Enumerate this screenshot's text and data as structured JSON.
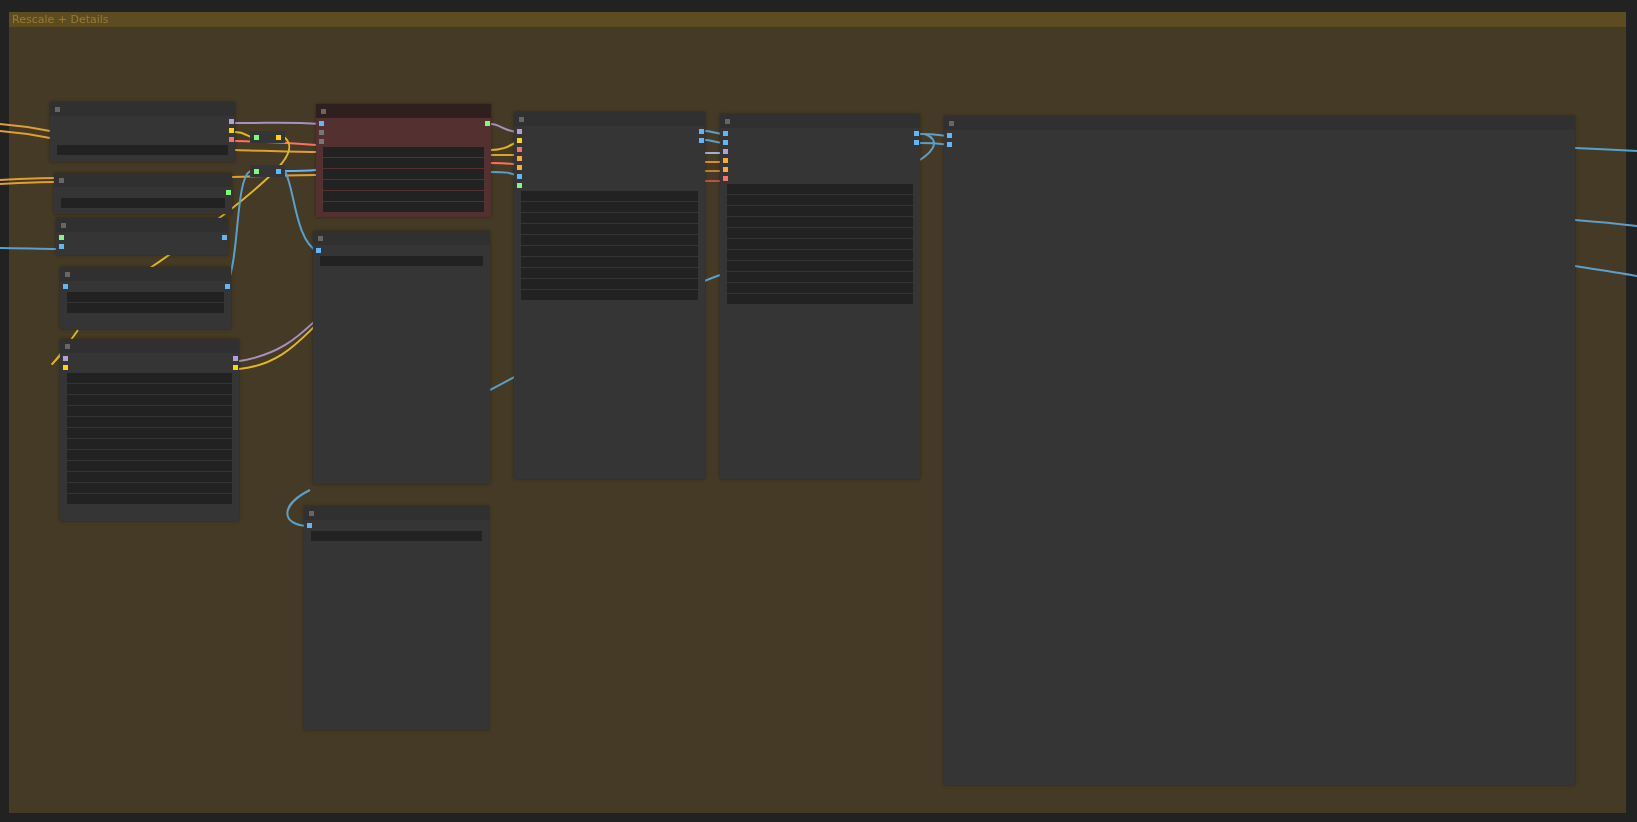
{
  "group": {
    "title": "Rescale + Details"
  },
  "nodes": [
    {
      "kind": "node",
      "outputs": [
        {
          "color": "#b39ddb"
        },
        {
          "color": "#ffd500"
        },
        {
          "color": "#ff6e6e"
        }
      ],
      "widgets": [
        {
          "kind": "field"
        }
      ]
    },
    {
      "kind": "reroute",
      "inputs": [
        {
          "color": "#7cfc7c"
        }
      ],
      "outputs": [
        {
          "color": "#ffd500"
        }
      ]
    },
    {
      "kind": "reroute",
      "inputs": [
        {
          "color": "#7cfc7c"
        }
      ],
      "outputs": [
        {
          "color": "#64b5f6"
        }
      ]
    },
    {
      "kind": "node",
      "outputs": [
        {
          "color": "#7cfc7c"
        }
      ],
      "widgets": [
        {
          "kind": "field"
        }
      ]
    },
    {
      "kind": "node",
      "inputs": [
        {
          "color": "#7cfc7c"
        },
        {
          "color": "#64b5f6"
        }
      ],
      "outputs": [
        {
          "color": "#64b5f6"
        }
      ]
    },
    {
      "kind": "node",
      "inputs": [
        {
          "color": "#64b5f6"
        }
      ],
      "outputs": [
        {
          "color": "#64b5f6"
        }
      ],
      "widgets": [
        {
          "kind": "field"
        },
        {
          "kind": "field"
        }
      ]
    },
    {
      "kind": "node",
      "inputs": [
        {
          "color": "#b39ddb"
        },
        {
          "color": "#ffd500"
        }
      ],
      "outputs": [
        {
          "color": "#b39ddb"
        },
        {
          "color": "#ffd500"
        }
      ],
      "widgets": [
        {
          "kind": "field"
        },
        {
          "kind": "field"
        },
        {
          "kind": "field"
        },
        {
          "kind": "field"
        },
        {
          "kind": "field"
        },
        {
          "kind": "field"
        },
        {
          "kind": "field"
        },
        {
          "kind": "field"
        },
        {
          "kind": "field"
        },
        {
          "kind": "field"
        },
        {
          "kind": "field"
        },
        {
          "kind": "field"
        }
      ]
    },
    {
      "kind": "node",
      "color": "#533131",
      "inputs": [
        {
          "color": "#64b5f6"
        },
        {
          "color": "#777777"
        },
        {
          "color": "#777777"
        }
      ],
      "outputs": [
        {
          "color": "#7cfc7c"
        }
      ],
      "widgets": [
        {
          "kind": "field"
        },
        {
          "kind": "field"
        },
        {
          "kind": "field"
        },
        {
          "kind": "field"
        },
        {
          "kind": "field"
        },
        {
          "kind": "field"
        }
      ]
    },
    {
      "kind": "node",
      "inputs": [
        {
          "color": "#64b5f6"
        }
      ],
      "widgets": [
        {
          "kind": "field"
        }
      ]
    },
    {
      "kind": "node",
      "inputs": [
        {
          "color": "#64b5f6"
        }
      ],
      "widgets": [
        {
          "kind": "field"
        }
      ]
    },
    {
      "kind": "node",
      "inputs": [
        {
          "color": "#b39ddb"
        },
        {
          "color": "#ffd500"
        },
        {
          "color": "#ff6e6e"
        },
        {
          "color": "#ffa931"
        },
        {
          "color": "#ffa931"
        },
        {
          "color": "#64b5f6"
        },
        {
          "color": "#7cfc7c"
        }
      ],
      "outputs": [
        {
          "color": "#64b5f6"
        },
        {
          "color": "#64b5f6"
        }
      ],
      "widgets": [
        {
          "kind": "field"
        },
        {
          "kind": "field"
        },
        {
          "kind": "field"
        },
        {
          "kind": "field"
        },
        {
          "kind": "field"
        },
        {
          "kind": "field"
        },
        {
          "kind": "field"
        },
        {
          "kind": "field"
        },
        {
          "kind": "field"
        },
        {
          "kind": "field"
        }
      ]
    },
    {
      "kind": "node",
      "inputs": [
        {
          "color": "#64b5f6"
        },
        {
          "color": "#64b5f6"
        },
        {
          "color": "#b39ddb"
        },
        {
          "color": "#ffa931"
        },
        {
          "color": "#ffa931"
        },
        {
          "color": "#ff6e6e"
        }
      ],
      "outputs": [
        {
          "color": "#64b5f6"
        },
        {
          "color": "#64b5f6"
        }
      ],
      "widgets": [
        {
          "kind": "field"
        },
        {
          "kind": "field"
        },
        {
          "kind": "field"
        },
        {
          "kind": "field"
        },
        {
          "kind": "field"
        },
        {
          "kind": "field"
        },
        {
          "kind": "field"
        },
        {
          "kind": "field"
        },
        {
          "kind": "field"
        },
        {
          "kind": "field"
        },
        {
          "kind": "field"
        }
      ]
    },
    {
      "kind": "node",
      "inputs": [
        {
          "color": "#64b5f6"
        },
        {
          "color": "#64b5f6"
        }
      ]
    }
  ]
}
